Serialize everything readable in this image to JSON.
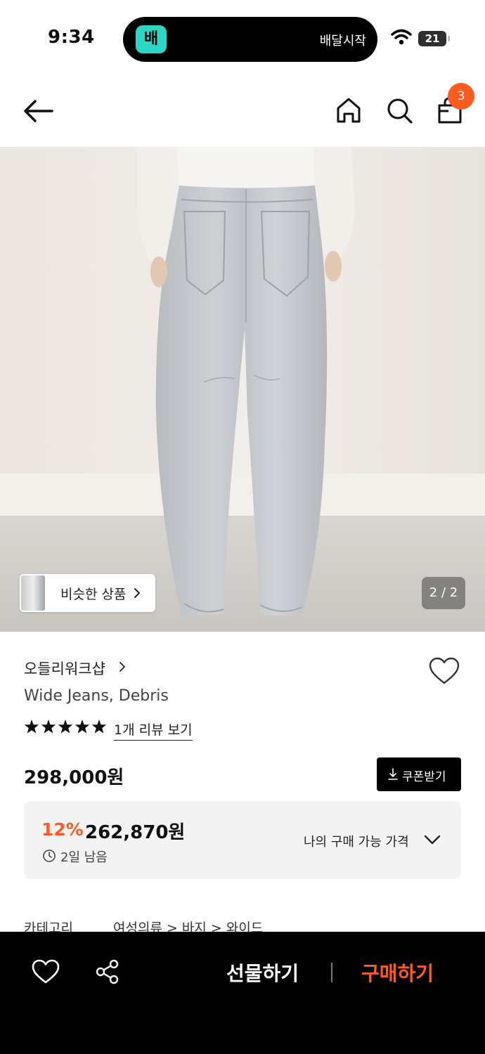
{
  "status_bar": {
    "time": "9:34",
    "island_logo": "배",
    "island_text": "배달시작",
    "battery": "21"
  },
  "header": {
    "icons": [
      "back-arrow-icon",
      "home-icon",
      "search-icon",
      "shopping-bag-icon"
    ],
    "cart_count": "3"
  },
  "gallery": {
    "similar_label": "비슷한 상품",
    "pager": "2 / 2"
  },
  "product": {
    "brand": "오들리워크샵",
    "name": "Wide Jeans, Debris",
    "rating_stars": 5,
    "review_link": "1개 리뷰 보기",
    "price": "298,000원",
    "coupon_label": "쿠폰받기",
    "discount_rate": "12%",
    "discount_price": "262,870원",
    "remaining": "2일 남음",
    "my_price_label": "나의 구매 가능 가격"
  },
  "category": {
    "label": "카테고리",
    "path": "여성의류 > 바지 > 와이드"
  },
  "bottom_bar": {
    "gift_label": "선물하기",
    "buy_label": "구매하기"
  },
  "colors": {
    "accent": "#ff5a1f",
    "island_logo": "#2bd6c4",
    "bottom_bar": "#000000"
  }
}
